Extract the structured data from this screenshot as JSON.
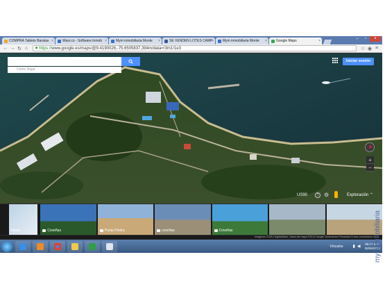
{
  "browser": {
    "tabs": [
      {
        "label": "COMPRA Tablets Baratas",
        "favicon_color": "#f5a623"
      },
      {
        "label": "Wasi.co - Software Inmob",
        "favicon_color": "#3b6fc7"
      },
      {
        "label": "Mym inmobiliaria Monte",
        "favicon_color": "#3b6fc7"
      },
      {
        "label": "SE VENDEN LOTES CAMP",
        "favicon_color": "#3b5998"
      },
      {
        "label": "Mym inmobiliaria Monte",
        "favicon_color": "#3b6fc7"
      },
      {
        "label": "Google Maps",
        "favicon_color": "#34a853"
      }
    ],
    "url_scheme": "https://",
    "url_rest": "www.google.es/maps/@9.4190026,-75.6505837,394m/data=!3m1!1e3"
  },
  "map": {
    "search_value": "",
    "search_placeholder": "",
    "how_to_get": "Cómo llegar",
    "signin_label": "Iniciar sesión",
    "scale": "US90",
    "exploration_label": "Exploración",
    "zoom_in": "+",
    "zoom_out": "−"
  },
  "photos": [
    {
      "label": "Mapa",
      "has_camera": false,
      "colors": [
        "#bcd3e6",
        "#e8eef4"
      ]
    },
    {
      "label": "Coveñas",
      "has_camera": true,
      "colors": [
        "#3b73b8",
        "#2a5a2c"
      ]
    },
    {
      "label": "Punta Piedra",
      "has_camera": true,
      "colors": [
        "#8fb3d8",
        "#c9a978"
      ]
    },
    {
      "label": "coveñas",
      "has_camera": true,
      "colors": [
        "#6a8db8",
        "#9c8f78"
      ]
    },
    {
      "label": "Coveñas",
      "has_camera": true,
      "colors": [
        "#4aa0d8",
        "#3d7a3a"
      ]
    },
    {
      "label": "",
      "has_camera": false,
      "colors": [
        "#a7b9c9",
        "#7a8a6b"
      ]
    },
    {
      "label": "",
      "has_camera": false,
      "colors": [
        "#c7d6e3",
        "#b8a37c"
      ]
    }
  ],
  "footer": "Imágenes ©2014 DigitalGlobe, Datos del mapa ©2014 Google   Condiciones   Privacidad   Enviar comentarios   30 m",
  "taskbar": {
    "lang": "Vínculos",
    "time": "08:17 a.m.",
    "date": "30/06/2014"
  },
  "watermark": "mym inmobiliaria"
}
